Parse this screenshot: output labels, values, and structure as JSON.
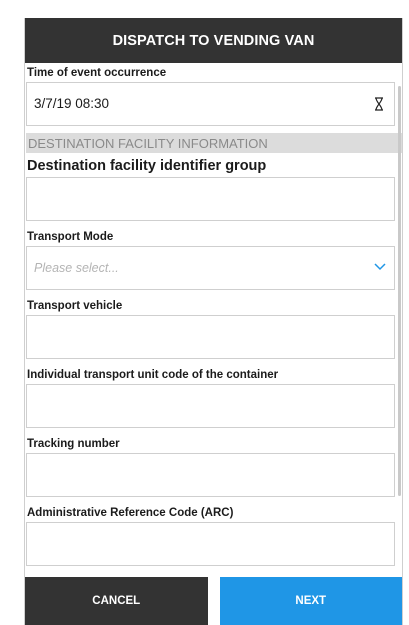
{
  "header": {
    "title": "DISPATCH TO VENDING VAN"
  },
  "event_time": {
    "label": "Time of event occurrence",
    "value": "3/7/19 08:30",
    "icon": "hourglass-icon"
  },
  "section": {
    "title": "DESTINATION FACILITY INFORMATION"
  },
  "facility_group": {
    "label": "Destination facility identifier group",
    "value": ""
  },
  "transport_mode": {
    "label": "Transport Mode",
    "placeholder": "Please select...",
    "icon": "chevron-down-icon"
  },
  "transport_vehicle": {
    "label": "Transport vehicle",
    "value": ""
  },
  "unit_code": {
    "label": "Individual transport unit code of the container",
    "value": ""
  },
  "tracking": {
    "label": "Tracking number",
    "value": ""
  },
  "arc": {
    "label": "Administrative Reference Code (ARC)",
    "value": ""
  },
  "footer": {
    "cancel_label": "CANCEL",
    "next_label": "NEXT"
  },
  "colors": {
    "header_bg": "#333333",
    "accent": "#1f96e6",
    "section_bg": "#dcdcdc"
  }
}
